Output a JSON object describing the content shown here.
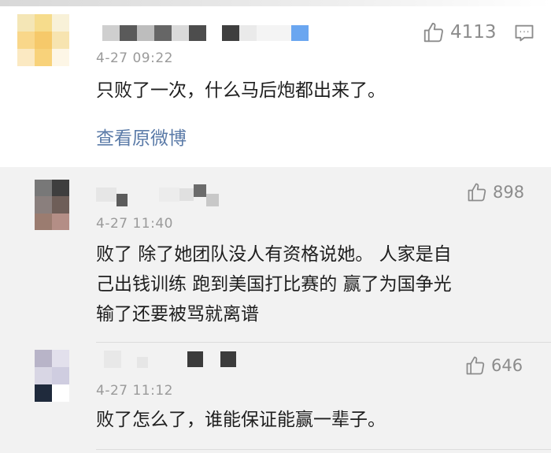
{
  "main_comment": {
    "time": "4-27 09:22",
    "text": "只败了一次，什么马后炮都出来了。",
    "likes": "4113",
    "view_original": "查看原微博",
    "like_icon": "thumbs-up-icon",
    "comment_icon": "comment-icon"
  },
  "replies": [
    {
      "time": "4-27 11:40",
      "lines": [
        "败了  除了她团队没人有资格说她。 人家是自",
        "己出钱训练 跑到美国打比赛的 赢了为国争光",
        "输了还要被骂就离谱"
      ],
      "likes": "898"
    },
    {
      "time": "4-27 11:12",
      "lines": [
        "败了怎么了，谁能保证能赢一辈子。"
      ],
      "likes": "646"
    }
  ],
  "colors": {
    "link": "#5b7ba8",
    "muted": "#9a9a9a",
    "reply_bg": "#f2f2f2"
  }
}
